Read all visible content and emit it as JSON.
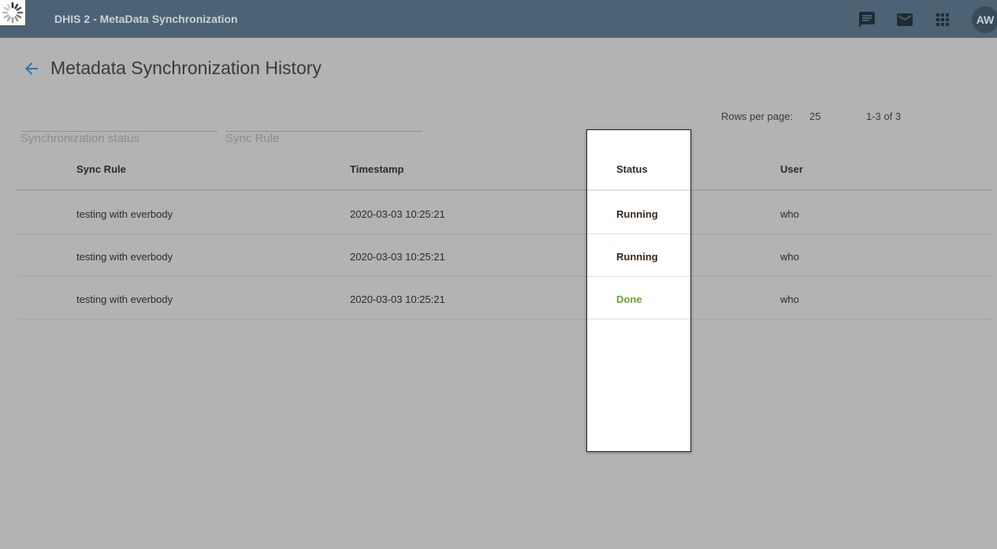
{
  "header": {
    "app_title": "DHIS 2 - MetaData Synchronization",
    "icons": [
      "spinner-logo",
      "message-icon",
      "mail-icon",
      "apps-icon"
    ],
    "avatar_initials": "AW",
    "colors": {
      "bar": "#4b6374",
      "text": "#c8d1d8"
    }
  },
  "page": {
    "title": "Metadata Synchronization History",
    "back_icon": "arrow-back-icon",
    "accent": "#2f73b7"
  },
  "pagination": {
    "rows_per_page_label": "Rows per page:",
    "rows_per_page_value": "25",
    "range": "1-3 of 3"
  },
  "filters": {
    "status_placeholder": "Synchronization status",
    "rule_placeholder": "Sync Rule"
  },
  "table": {
    "columns": [
      "Sync Rule",
      "Timestamp",
      "Status",
      "User"
    ],
    "rows": [
      {
        "rule": "testing with everbody",
        "timestamp": "2020-03-03 10:25:21",
        "status": "Running",
        "user": "who"
      },
      {
        "rule": "testing with everbody",
        "timestamp": "2020-03-03 10:25:21",
        "status": "Running",
        "user": "who"
      },
      {
        "rule": "testing with everbody",
        "timestamp": "2020-03-03 10:25:21",
        "status": "Done",
        "user": "who"
      }
    ],
    "status_colors": {
      "Running": "#3b2a1f",
      "Done": "#6aa532"
    }
  }
}
